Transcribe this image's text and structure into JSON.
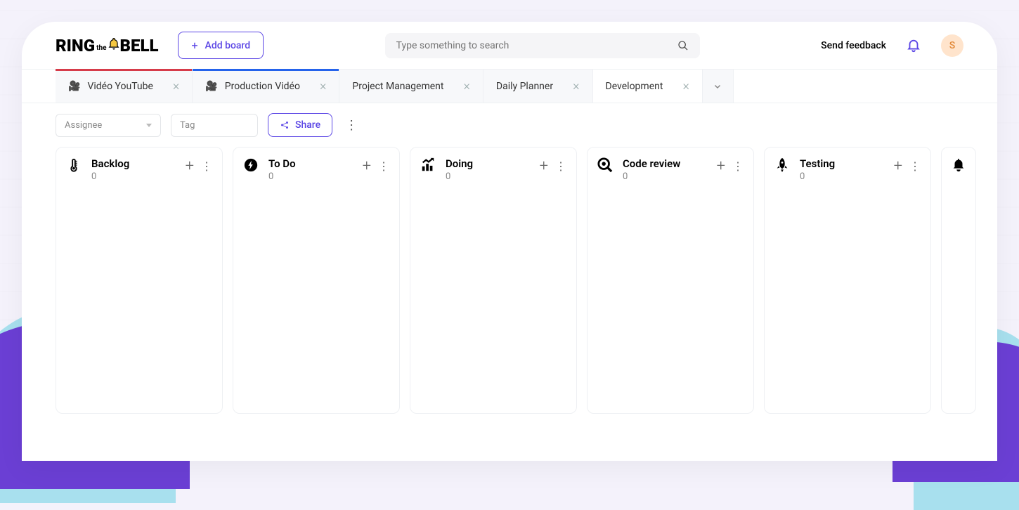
{
  "logo": {
    "part1": "RING",
    "the": "the",
    "part2": "BELL"
  },
  "header": {
    "add_board_label": "Add board",
    "search_placeholder": "Type something to search",
    "feedback_label": "Send feedback",
    "avatar_initial": "S"
  },
  "tabs": [
    {
      "label": "Vidéo YouTube",
      "has_icon": true,
      "bar": "red",
      "active": false
    },
    {
      "label": "Production Vidéo",
      "has_icon": true,
      "bar": "blue",
      "active": false
    },
    {
      "label": "Project Management",
      "has_icon": false,
      "bar": null,
      "active": false
    },
    {
      "label": "Daily Planner",
      "has_icon": false,
      "bar": null,
      "active": false
    },
    {
      "label": "Development",
      "has_icon": false,
      "bar": null,
      "active": true
    }
  ],
  "toolbar": {
    "assignee_label": "Assignee",
    "tag_label": "Tag",
    "share_label": "Share"
  },
  "columns": [
    {
      "name": "Backlog",
      "count": "0",
      "icon": "thermometer"
    },
    {
      "name": "To Do",
      "count": "0",
      "icon": "bolt-circle"
    },
    {
      "name": "Doing",
      "count": "0",
      "icon": "chart-up"
    },
    {
      "name": "Code review",
      "count": "0",
      "icon": "search-code"
    },
    {
      "name": "Testing",
      "count": "0",
      "icon": "rocket"
    },
    {
      "name": "",
      "count": "",
      "icon": "bell-solid"
    }
  ]
}
